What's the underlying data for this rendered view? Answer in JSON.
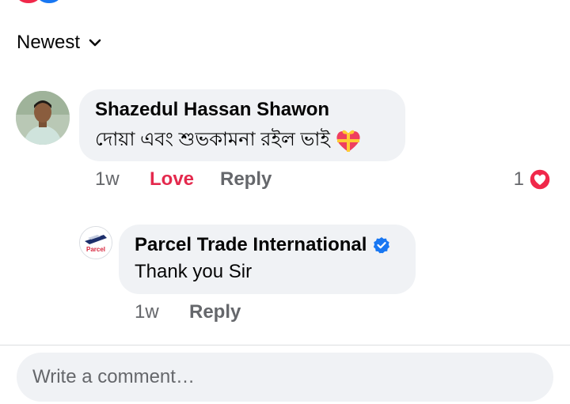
{
  "sort": {
    "label": "Newest"
  },
  "comments": [
    {
      "author": "Shazedul Hassan Shawon",
      "text": "দোয়া এবং শুভকামনা রইল ভাই",
      "time": "1w",
      "reaction_label": "Love",
      "reply_label": "Reply",
      "reaction_count": "1",
      "reaction_icon": "heart-reaction-icon",
      "text_emoji_icon": "heart-gift-emoji-icon",
      "reaction_color": "#e4294d"
    },
    {
      "author": "Parcel Trade International",
      "verified": true,
      "verified_icon": "verified-badge-icon",
      "avatar_text": "Parcel",
      "text": "Thank you Sir",
      "time": "1w",
      "reply_label": "Reply"
    }
  ],
  "composer": {
    "placeholder": "Write a comment…"
  },
  "colors": {
    "accent": "#1877f2",
    "love": "#e4294d",
    "bubble": "#f0f2f5",
    "muted": "#65676b"
  }
}
